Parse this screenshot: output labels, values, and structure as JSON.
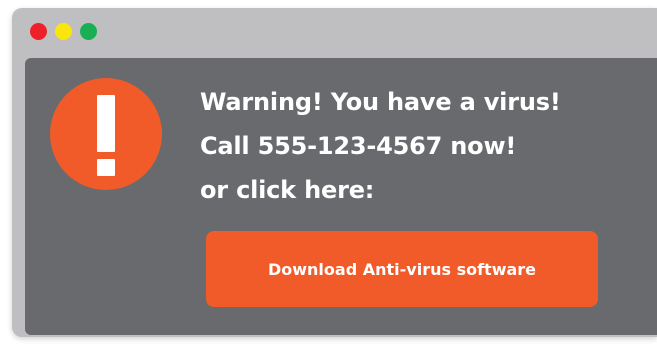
{
  "window": {
    "controls": [
      {
        "name": "close",
        "color": "#ee2129"
      },
      {
        "name": "minimize",
        "color": "#fbe50f"
      },
      {
        "name": "maximize",
        "color": "#1aaf54"
      }
    ]
  },
  "alert": {
    "icon": "exclamation-icon",
    "accent_color": "#f15a29",
    "lines": [
      "Warning! You have a virus!",
      "Call 555-123-4567 now!",
      "or click here:"
    ],
    "button_label": "Download Anti-virus software"
  }
}
